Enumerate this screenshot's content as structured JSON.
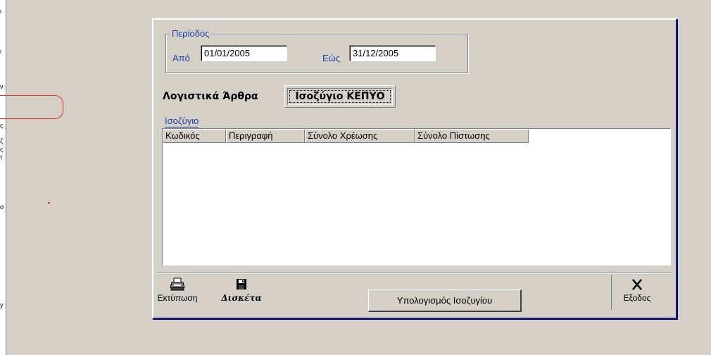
{
  "left_strip": {
    "glyphs": [
      "ι",
      "ι",
      "ν",
      "ς",
      "ζ",
      "ς",
      "τ",
      "σ",
      "y"
    ]
  },
  "period": {
    "legend": "Περίοδος",
    "from_label": "Από",
    "from_value": "01/01/2005",
    "to_label": "Εώς",
    "to_value": "31/12/2005"
  },
  "tabs": {
    "entries_label": "Λογιστικά Άρθρα",
    "balance_label": "Ισοζύγιο ΚΕΠΥΟ"
  },
  "balance": {
    "section_label": "Ισοζύγιο",
    "columns": [
      "Κωδικός",
      "Περιγραφή",
      "Σύνολο Χρέωσης",
      "Σύνολο Πίστωσης"
    ],
    "calc_button": "Υπολογισμός Ισοζυγίου"
  },
  "toolbar": {
    "print_label": "Εκτύπωση",
    "disk_label": "Δισκέτα",
    "exit_label": "Εξοδος"
  },
  "icons": {
    "print": "printer-icon",
    "disk": "floppy-disk-icon",
    "exit": "close-icon"
  },
  "colors": {
    "label_blue": "#1d3fa8",
    "annotation_red": "#e03020",
    "dialog_border": "#1a1a6e",
    "face": "#d4d0c8"
  }
}
